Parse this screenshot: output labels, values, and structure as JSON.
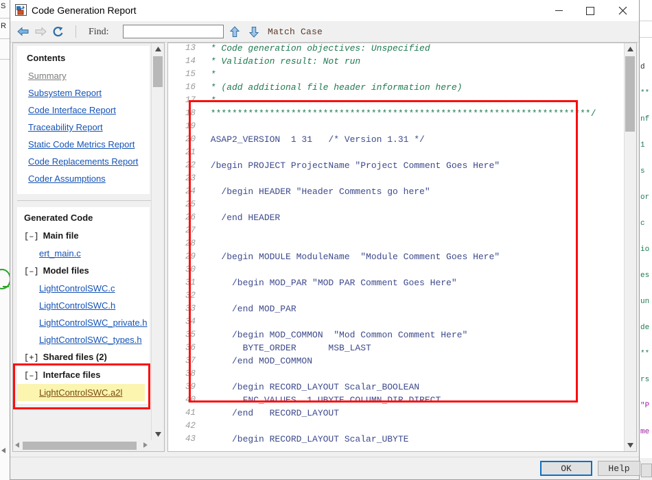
{
  "window": {
    "title": "Code Generation Report",
    "icon": "report-app-icon",
    "controls": {
      "minimize": "—",
      "maximize": "□",
      "close": "✕"
    }
  },
  "toolbar": {
    "back_icon": "back-arrow-icon",
    "forward_icon": "forward-arrow-icon",
    "refresh_icon": "refresh-icon",
    "find_label": "Find:",
    "find_value": "",
    "find_placeholder": "",
    "find_prev_icon": "up-arrow-icon",
    "find_next_icon": "down-arrow-icon",
    "match_case_label": "Match Case"
  },
  "sidebar": {
    "contents_heading": "Contents",
    "contents_links": [
      {
        "label": "Summary",
        "visited": true
      },
      {
        "label": "Subsystem Report",
        "visited": false
      },
      {
        "label": "Code Interface Report",
        "visited": false
      },
      {
        "label": "Traceability Report",
        "visited": false
      },
      {
        "label": "Static Code Metrics Report",
        "visited": false
      },
      {
        "label": "Code Replacements Report",
        "visited": false
      },
      {
        "label": "Coder Assumptions",
        "visited": false
      }
    ],
    "generated_heading": "Generated Code",
    "groups": [
      {
        "toggle": "[–]",
        "label": "Main file",
        "files": [
          "ert_main.c"
        ]
      },
      {
        "toggle": "[–]",
        "label": "Model files",
        "files": [
          "LightControlSWC.c",
          "LightControlSWC.h",
          "LightControlSWC_private.h",
          "LightControlSWC_types.h"
        ]
      },
      {
        "toggle": "[+]",
        "label": "Shared files (2)",
        "files": []
      },
      {
        "toggle": "[–]",
        "label": "Interface files",
        "files": [
          "LightControlSWC.a2l"
        ]
      }
    ],
    "selected_file": "LightControlSWC.a2l"
  },
  "code": {
    "lines": [
      {
        "n": "13",
        "text": " * Code generation objectives: Unspecified",
        "style": "c-comment"
      },
      {
        "n": "14",
        "text": " * Validation result: Not run",
        "style": "c-comment"
      },
      {
        "n": "15",
        "text": " *",
        "style": "c-comment"
      },
      {
        "n": "16",
        "text": " * (add additional file header information here)",
        "style": "c-comment"
      },
      {
        "n": "17",
        "text": " *",
        "style": "c-comment"
      },
      {
        "n": "18",
        "text": " ***********************************************************************/",
        "style": "c-stars"
      },
      {
        "n": "19",
        "text": "",
        "style": "c-code"
      },
      {
        "n": "20",
        "text": " ASAP2_VERSION  1 31   /* Version 1.31 */",
        "style": "c-code"
      },
      {
        "n": "21",
        "text": "",
        "style": "c-code"
      },
      {
        "n": "22",
        "text": " /begin PROJECT ProjectName \"Project Comment Goes Here\"",
        "style": "c-code"
      },
      {
        "n": "23",
        "text": "",
        "style": "c-code"
      },
      {
        "n": "24",
        "text": "   /begin HEADER \"Header Comments go here\"",
        "style": "c-code"
      },
      {
        "n": "25",
        "text": "",
        "style": "c-code"
      },
      {
        "n": "26",
        "text": "   /end HEADER",
        "style": "c-code"
      },
      {
        "n": "27",
        "text": "",
        "style": "c-code"
      },
      {
        "n": "28",
        "text": "",
        "style": "c-code"
      },
      {
        "n": "29",
        "text": "   /begin MODULE ModuleName  \"Module Comment Goes Here\"",
        "style": "c-code"
      },
      {
        "n": "30",
        "text": "",
        "style": "c-code"
      },
      {
        "n": "31",
        "text": "     /begin MOD_PAR \"MOD PAR Comment Goes Here\"",
        "style": "c-code"
      },
      {
        "n": "32",
        "text": "",
        "style": "c-code"
      },
      {
        "n": "33",
        "text": "     /end MOD_PAR",
        "style": "c-code"
      },
      {
        "n": "34",
        "text": "",
        "style": "c-code"
      },
      {
        "n": "35",
        "text": "     /begin MOD_COMMON  \"Mod Common Comment Here\"",
        "style": "c-code"
      },
      {
        "n": "36",
        "text": "       BYTE_ORDER      MSB_LAST",
        "style": "c-code"
      },
      {
        "n": "37",
        "text": "     /end MOD_COMMON",
        "style": "c-code"
      },
      {
        "n": "38",
        "text": "",
        "style": "c-code"
      },
      {
        "n": "39",
        "text": "     /begin RECORD_LAYOUT Scalar_BOOLEAN",
        "style": "c-code"
      },
      {
        "n": "40",
        "text": "       FNC_VALUES  1 UBYTE COLUMN_DIR DIRECT",
        "style": "c-code"
      },
      {
        "n": "41",
        "text": "     /end   RECORD_LAYOUT",
        "style": "c-code"
      },
      {
        "n": "42",
        "text": "",
        "style": "c-code"
      },
      {
        "n": "43",
        "text": "     /begin RECORD_LAYOUT Scalar_UBYTE",
        "style": "c-code"
      }
    ]
  },
  "footer": {
    "ok_label": "OK",
    "help_label": "Help"
  },
  "background": {
    "left_labels": [
      "S",
      "R"
    ],
    "right_code_lines": [
      {
        "text": "d",
        "color": "#2f2f2f"
      },
      {
        "text": "**",
        "color": "#1f7a52"
      },
      {
        "text": "nf",
        "color": "#1f7a52"
      },
      {
        "text": "1",
        "color": "#1f7a52"
      },
      {
        "text": "s",
        "color": "#1f7a52"
      },
      {
        "text": "or",
        "color": "#1f7a52"
      },
      {
        "text": "c",
        "color": "#1f7a52"
      },
      {
        "text": "io",
        "color": "#1f7a52"
      },
      {
        "text": "es",
        "color": "#1f7a52"
      },
      {
        "text": "un",
        "color": "#1f7a52"
      },
      {
        "text": "de",
        "color": "#1f7a52"
      },
      {
        "text": "**",
        "color": "#1f7a52"
      },
      {
        "text": "rs",
        "color": "#1f7a52"
      },
      {
        "text": "\"P",
        "color": "#a020a0"
      },
      {
        "text": "me",
        "color": "#a020a0"
      }
    ]
  },
  "colors": {
    "accent_red": "#fb0d0d",
    "link": "#1553b6",
    "comment_green": "#1f7a52",
    "code_blue": "#3d4a8c",
    "highlight_yellow": "#fbf5b0",
    "focus_blue": "#0a6fc2"
  }
}
